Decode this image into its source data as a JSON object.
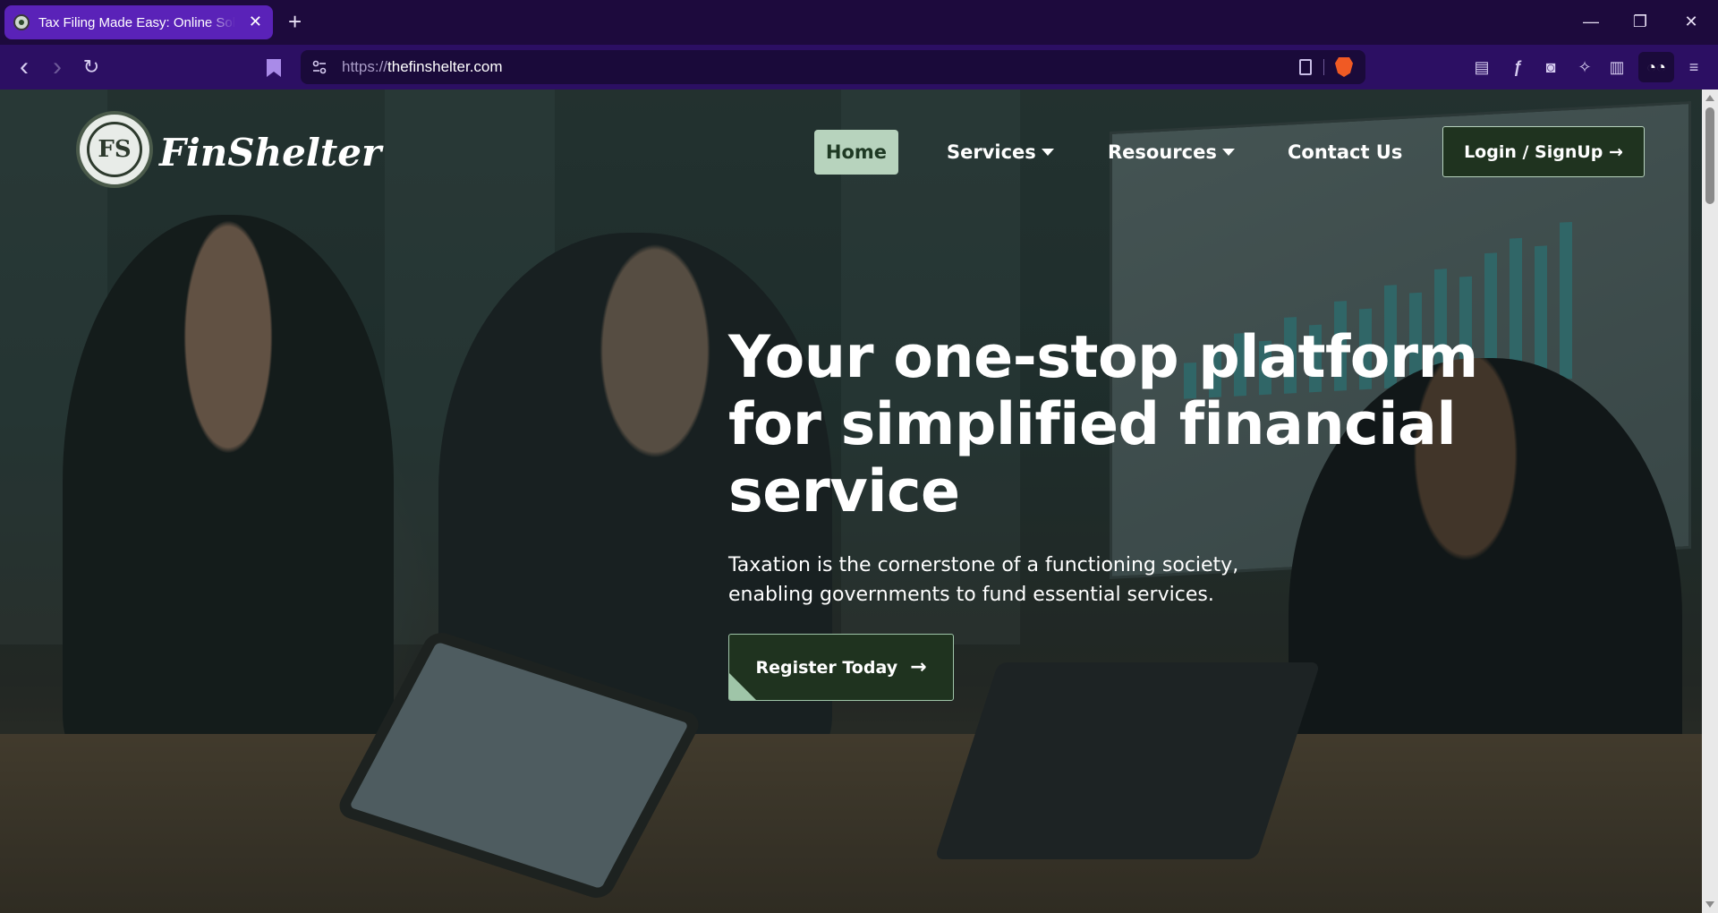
{
  "browser": {
    "tab_title": "Tax Filing Made Easy: Online Solutions",
    "tab_close": "✕",
    "new_tab": "+",
    "url_protocol": "https://",
    "url_host": "thefinshelter.com",
    "window_controls": {
      "minimize": "—",
      "restore": "❐",
      "close": "✕"
    },
    "nav": {
      "back": "‹",
      "forward": "›",
      "reload": "↻"
    }
  },
  "site": {
    "logo_monogram": "FS",
    "brand": "FinShelter",
    "nav": {
      "home": "Home",
      "services": "Services",
      "resources": "Resources",
      "contact": "Contact Us"
    },
    "login_label": "Login / SignUp →",
    "hero": {
      "title_line1": "Your one-stop platform",
      "title_line2": "for simplified financial",
      "title_line3": "service",
      "subtitle_line1": "Taxation is the cornerstone of a functioning society,",
      "subtitle_line2": "enabling governments to fund essential services.",
      "cta_label": "Register Today",
      "cta_arrow": "→"
    }
  },
  "colors": {
    "accent_green": "#1f331f",
    "accent_light_green": "#b7d3bd",
    "browser_purple": "#2c0f63"
  }
}
